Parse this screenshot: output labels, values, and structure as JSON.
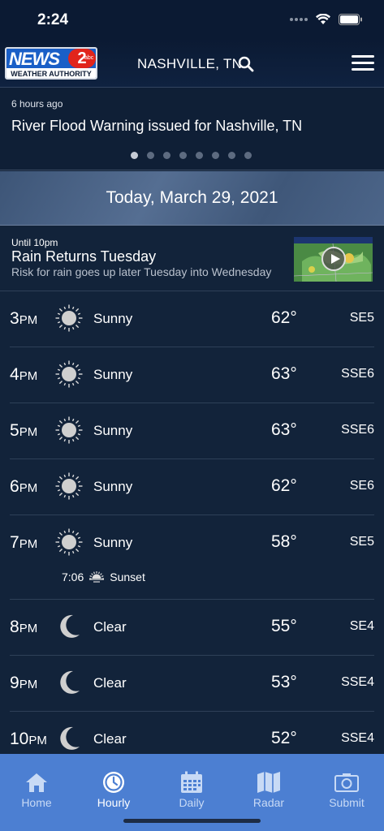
{
  "status_bar": {
    "time": "2:24"
  },
  "header": {
    "logo_text": "NEWS",
    "logo_number": "2",
    "logo_network": "abc",
    "logo_tagline": "WEATHER AUTHORITY",
    "location": "NASHVILLE, TN"
  },
  "alert": {
    "time_ago": "6 hours ago",
    "title": "River Flood Warning issued for Nashville, TN",
    "page_count": 8,
    "active_page": 1
  },
  "date_bar": {
    "date": "Today, March 29, 2021"
  },
  "story": {
    "until": "Until 10pm",
    "title": "Rain Returns Tuesday",
    "description": "Risk for rain goes up later Tuesday into Wednesday"
  },
  "hours": [
    {
      "hour": "3",
      "ampm": "PM",
      "icon": "sun-icon",
      "condition": "Sunny",
      "temp": "62°",
      "wind": "SE5"
    },
    {
      "hour": "4",
      "ampm": "PM",
      "icon": "sun-icon",
      "condition": "Sunny",
      "temp": "63°",
      "wind": "SSE6"
    },
    {
      "hour": "5",
      "ampm": "PM",
      "icon": "sun-icon",
      "condition": "Sunny",
      "temp": "63°",
      "wind": "SSE6"
    },
    {
      "hour": "6",
      "ampm": "PM",
      "icon": "sun-icon",
      "condition": "Sunny",
      "temp": "62°",
      "wind": "SE6"
    },
    {
      "hour": "7",
      "ampm": "PM",
      "icon": "sun-icon",
      "condition": "Sunny",
      "temp": "58°",
      "wind": "SE5",
      "sunset_time": "7:06",
      "sunset_label": "Sunset"
    },
    {
      "hour": "8",
      "ampm": "PM",
      "icon": "moon-icon",
      "condition": "Clear",
      "temp": "55°",
      "wind": "SE4"
    },
    {
      "hour": "9",
      "ampm": "PM",
      "icon": "moon-icon",
      "condition": "Clear",
      "temp": "53°",
      "wind": "SSE4"
    },
    {
      "hour": "10",
      "ampm": "PM",
      "icon": "moon-icon",
      "condition": "Clear",
      "temp": "52°",
      "wind": "SSE4"
    }
  ],
  "tabs": [
    {
      "label": "Home",
      "icon": "home-icon"
    },
    {
      "label": "Hourly",
      "icon": "clock-icon",
      "active": true
    },
    {
      "label": "Daily",
      "icon": "calendar-icon"
    },
    {
      "label": "Radar",
      "icon": "map-icon"
    },
    {
      "label": "Submit",
      "icon": "camera-icon"
    }
  ],
  "colors": {
    "background": "#12233a",
    "tab_bar": "#4c7fd2",
    "header": "#0b1a33"
  }
}
